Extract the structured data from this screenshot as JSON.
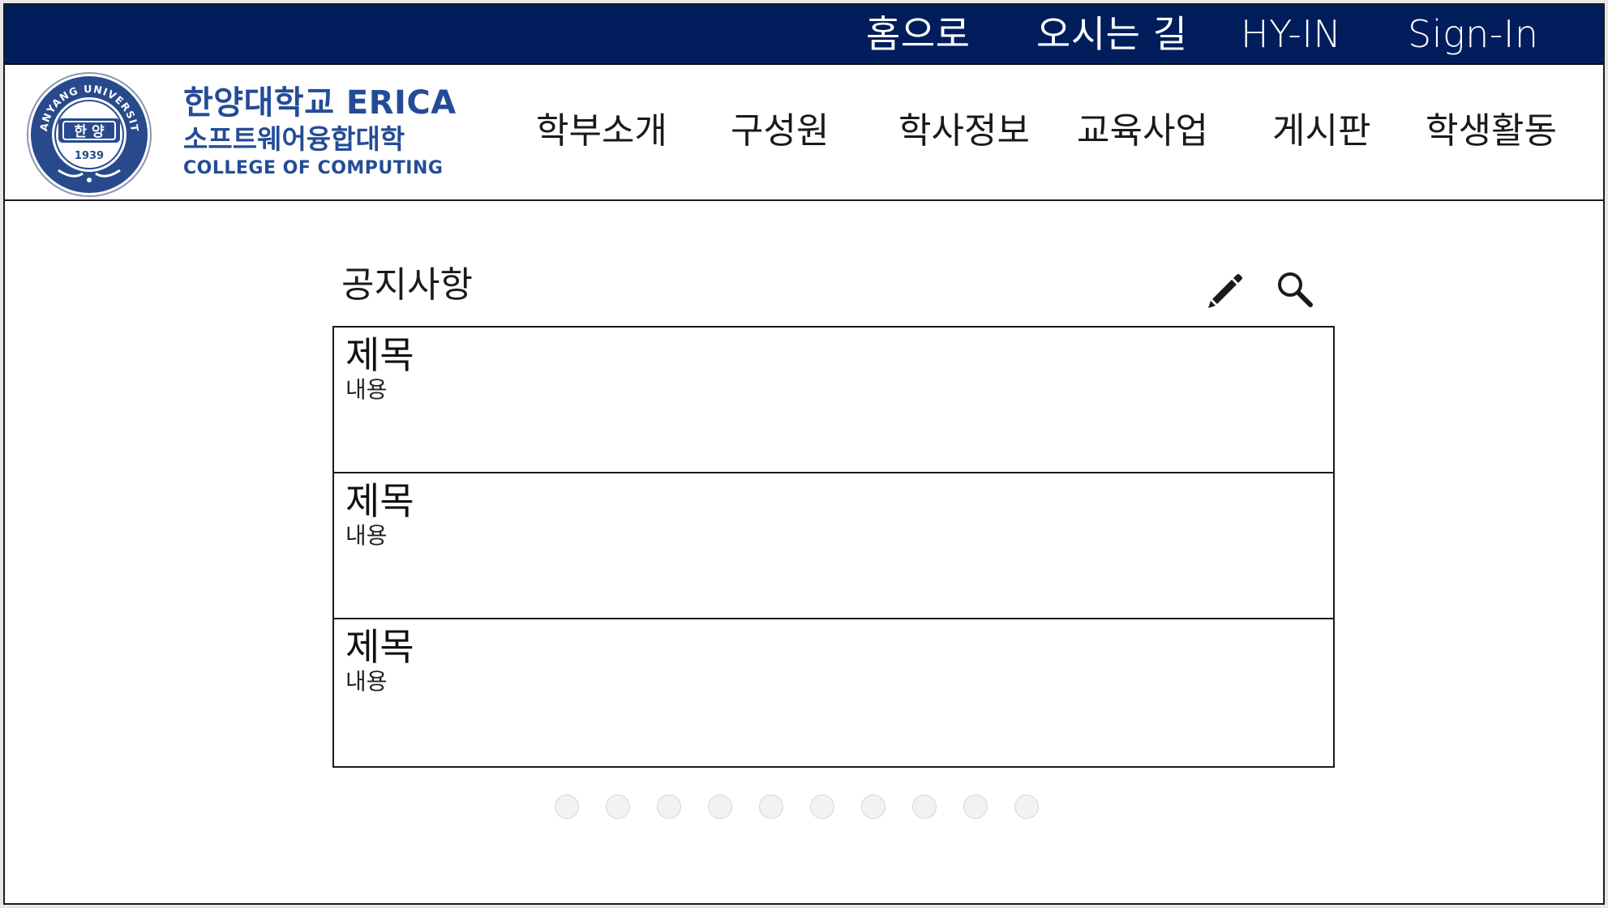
{
  "topbar": {
    "links": [
      "홈으로",
      "오시는 길",
      "HY-IN",
      "Sign-In"
    ]
  },
  "header": {
    "emblem": {
      "ring_text": "HANYANG UNIVERSITY",
      "center_text": "한 양",
      "year": "1939"
    },
    "brand": {
      "line1": "한양대학교 ERICA",
      "line2": "소프트웨어융합대학",
      "line3": "COLLEGE OF COMPUTING"
    },
    "nav": [
      "학부소개",
      "구성원",
      "학사정보",
      "교육사업",
      "게시판",
      "학생활동"
    ]
  },
  "board": {
    "title": "공지사항",
    "icons": [
      "pencil-icon",
      "search-icon"
    ],
    "items": [
      {
        "title": "제목",
        "body": "내용"
      },
      {
        "title": "제목",
        "body": "내용"
      },
      {
        "title": "제목",
        "body": "내용"
      }
    ],
    "page_count": 10
  },
  "colors": {
    "topbar": "#011d5c",
    "brand": "#234c98",
    "dot": "#f2f2f2"
  }
}
